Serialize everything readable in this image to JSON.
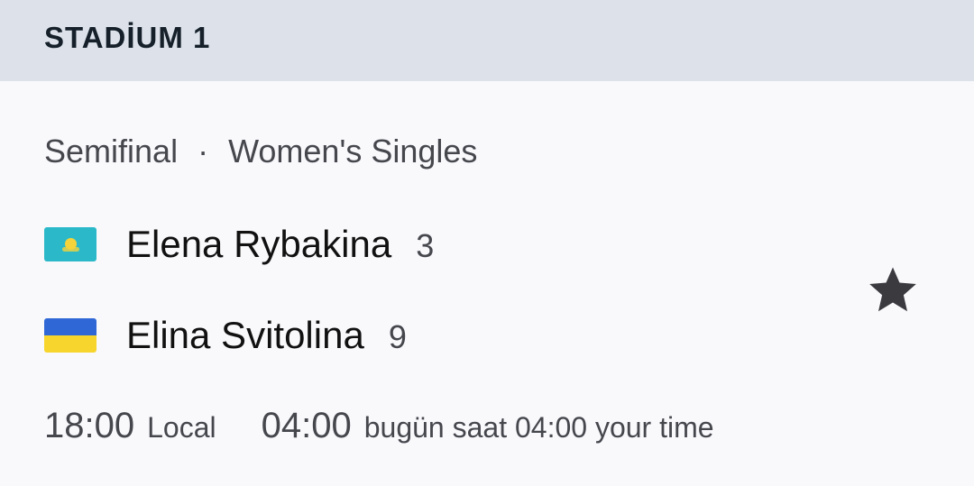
{
  "header": {
    "court_name": "STADİUM 1"
  },
  "match": {
    "round": "Semifinal",
    "separator": "·",
    "event": "Women's Singles",
    "players": [
      {
        "name": "Elena Rybakina",
        "seed": "3",
        "flag": "kazakhstan-flag-icon"
      },
      {
        "name": "Elina Svitolina",
        "seed": "9",
        "flag": "ukraine-flag-icon"
      }
    ],
    "favorite_icon": "star-icon",
    "local_time": "18:00",
    "local_label": "Local",
    "your_time": "04:00",
    "your_time_label": "bugün saat 04:00 your time"
  },
  "colors": {
    "header_bg": "#dde2ea",
    "card_bg": "#f9f9fc",
    "kz_flag": "#2bb9c9",
    "ua_blue": "#2f68d6",
    "ua_yellow": "#f7d52c"
  }
}
